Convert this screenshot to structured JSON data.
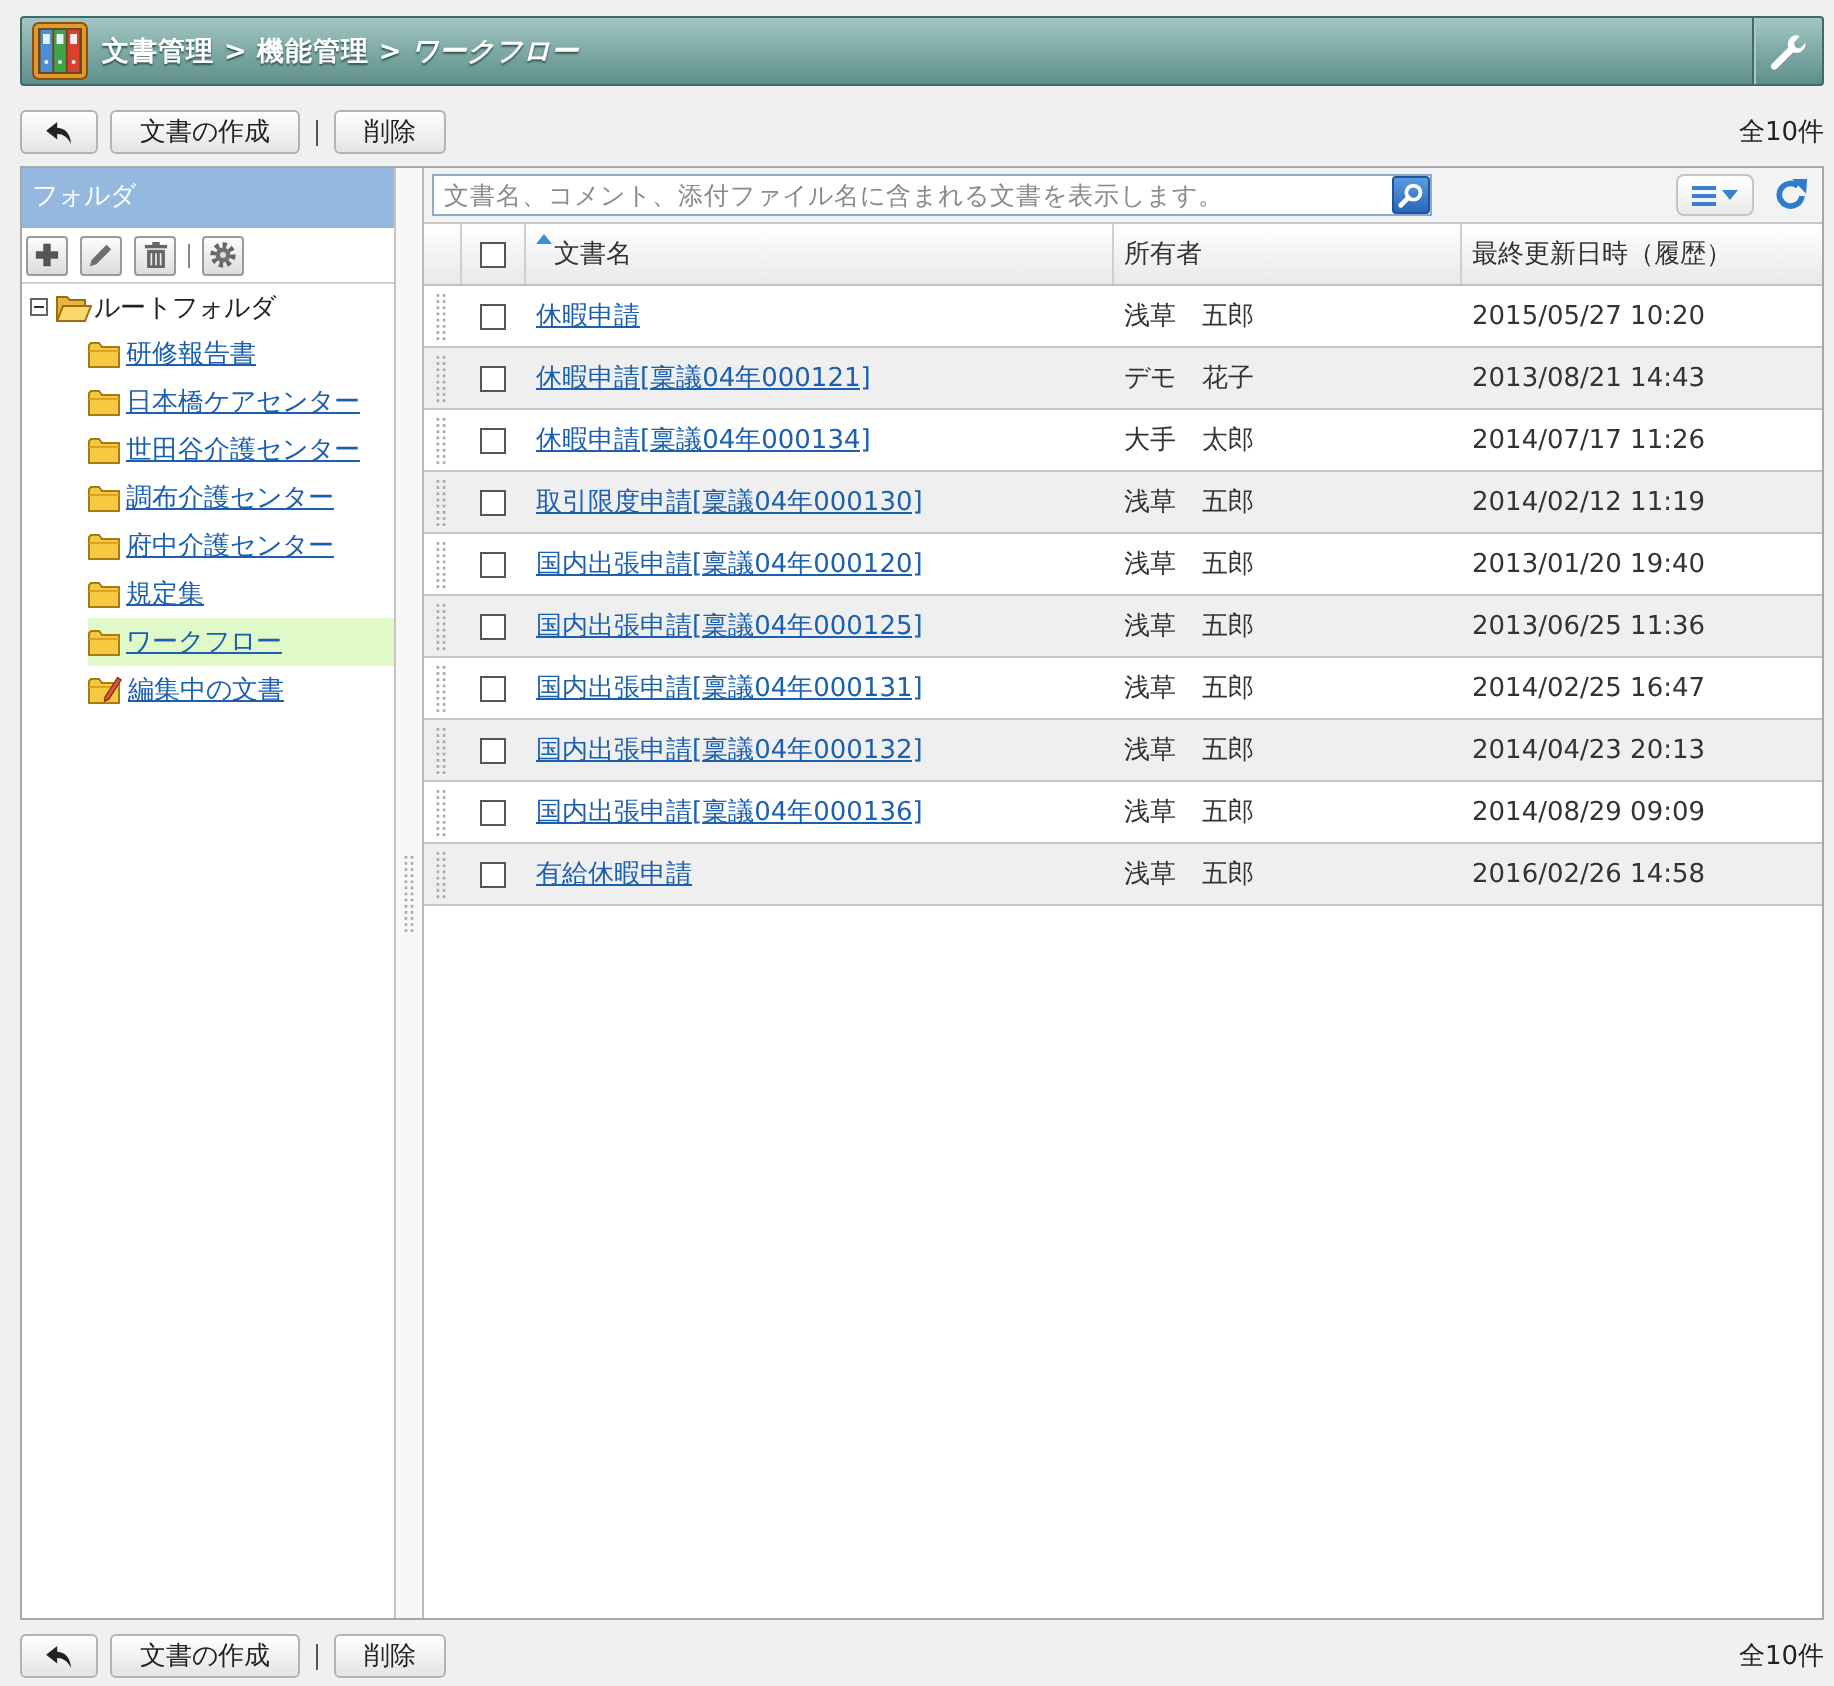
{
  "header": {
    "breadcrumb": [
      {
        "label": "文書管理",
        "current": false,
        "separator": ">"
      },
      {
        "label": "機能管理",
        "current": false,
        "separator": ">"
      },
      {
        "label": "ワークフロー",
        "current": true
      }
    ]
  },
  "toolbar_top": {
    "buttons": [
      {
        "kind": "back"
      },
      {
        "kind": "text",
        "label": "文書の作成"
      },
      {
        "kind": "divider"
      },
      {
        "kind": "text",
        "label": "削除"
      }
    ],
    "count": "全10件"
  },
  "sidebar": {
    "title": "フォルダ",
    "tree": {
      "label": "ルートフォルダ",
      "expanded": true,
      "selected": false,
      "children": [
        {
          "label": "研修報告書",
          "kind": "folder",
          "selected": false
        },
        {
          "label": "日本橋ケアセンター",
          "kind": "folder",
          "selected": false
        },
        {
          "label": "世田谷介護センター",
          "kind": "folder",
          "selected": false
        },
        {
          "label": "調布介護センター",
          "kind": "folder",
          "selected": false
        },
        {
          "label": "府中介護センター",
          "kind": "folder",
          "selected": false
        },
        {
          "label": "規定集",
          "kind": "folder",
          "selected": false
        },
        {
          "label": "ワークフロー",
          "kind": "folder",
          "selected": true
        },
        {
          "label": "編集中の文書",
          "kind": "drafts",
          "selected": false
        }
      ]
    }
  },
  "search": {
    "placeholder": "文書名、コメント、添付ファイル名に含まれる文書を表示します。"
  },
  "table": {
    "select_all": {
      "checked": false
    },
    "columns": [
      {
        "label": "文書名",
        "sorted": true
      },
      {
        "label": "所有者",
        "sorted": false
      },
      {
        "label": "最終更新日時（履歴）",
        "sorted": false
      }
    ],
    "rows": [
      {
        "name": "休暇申請",
        "owner": "浅草　五郎",
        "updated": "2015/05/27 10:20",
        "checked": false
      },
      {
        "name": "休暇申請[稟議04年000121]",
        "owner": "デモ　花子",
        "updated": "2013/08/21 14:43",
        "checked": false
      },
      {
        "name": "休暇申請[稟議04年000134]",
        "owner": "大手　太郎",
        "updated": "2014/07/17 11:26",
        "checked": false
      },
      {
        "name": "取引限度申請[稟議04年000130]",
        "owner": "浅草　五郎",
        "updated": "2014/02/12 11:19",
        "checked": false
      },
      {
        "name": "国内出張申請[稟議04年000120]",
        "owner": "浅草　五郎",
        "updated": "2013/01/20 19:40",
        "checked": false
      },
      {
        "name": "国内出張申請[稟議04年000125]",
        "owner": "浅草　五郎",
        "updated": "2013/06/25 11:36",
        "checked": false
      },
      {
        "name": "国内出張申請[稟議04年000131]",
        "owner": "浅草　五郎",
        "updated": "2014/02/25 16:47",
        "checked": false
      },
      {
        "name": "国内出張申請[稟議04年000132]",
        "owner": "浅草　五郎",
        "updated": "2014/04/23 20:13",
        "checked": false
      },
      {
        "name": "国内出張申請[稟議04年000136]",
        "owner": "浅草　五郎",
        "updated": "2014/08/29 09:09",
        "checked": false
      },
      {
        "name": "有給休暇申請",
        "owner": "浅草　五郎",
        "updated": "2016/02/26 14:58",
        "checked": false
      }
    ]
  },
  "toolbar_bottom": {
    "buttons": [
      {
        "kind": "back"
      },
      {
        "kind": "text",
        "label": "文書の作成"
      },
      {
        "kind": "divider"
      },
      {
        "kind": "text",
        "label": "削除"
      }
    ],
    "count": "全10件"
  }
}
